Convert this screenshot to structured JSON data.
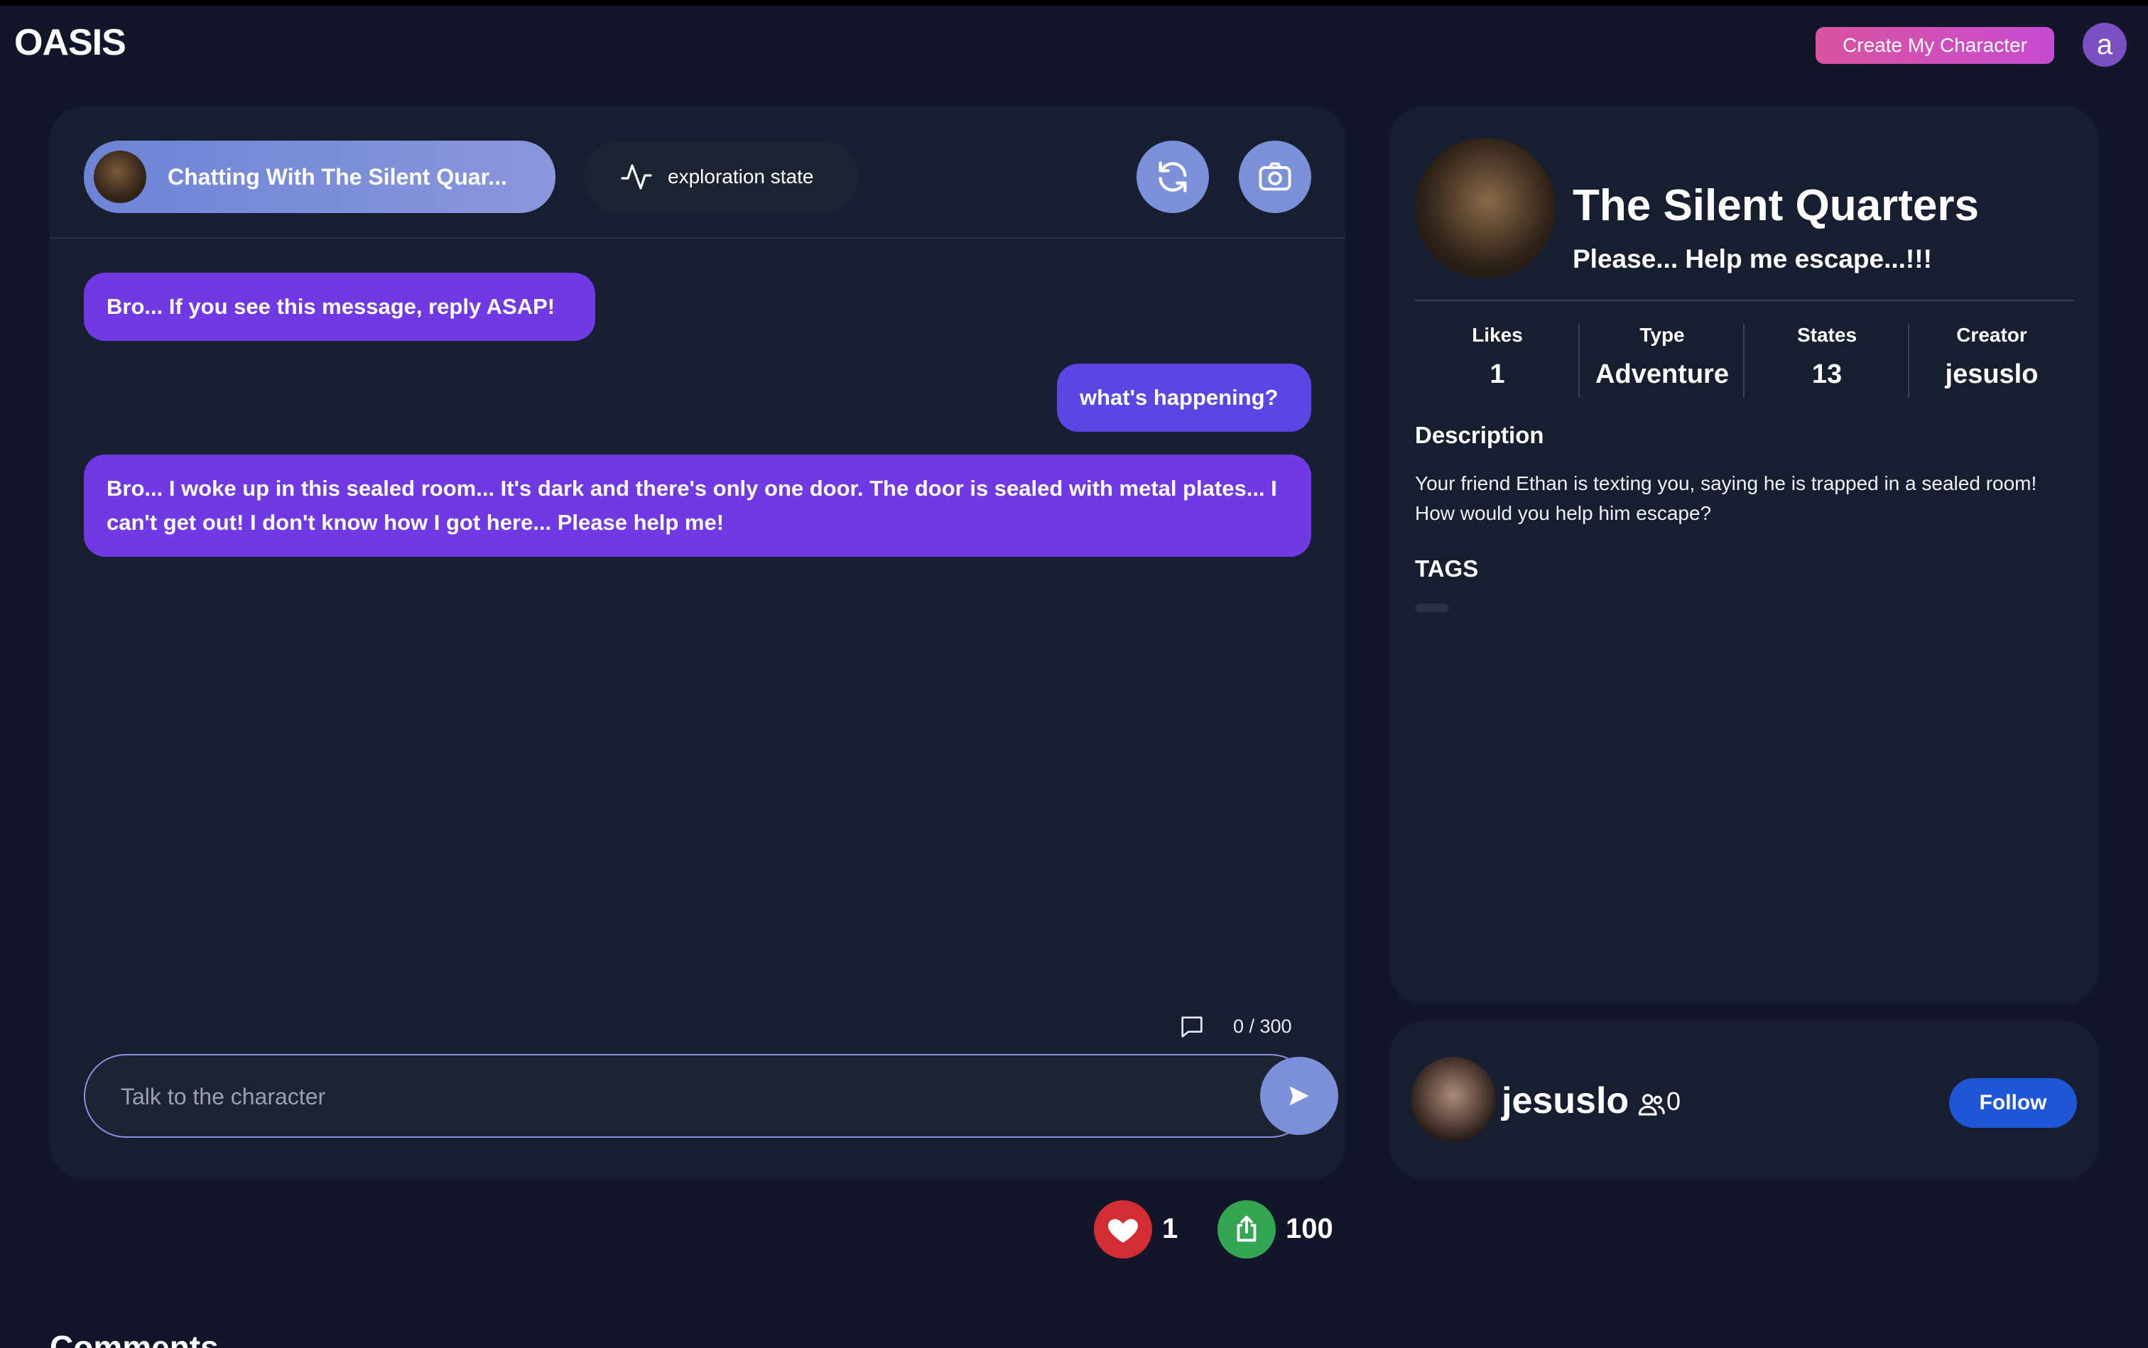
{
  "header": {
    "logo": "OASIS",
    "create_button": "Create My Character",
    "user_initial": "a"
  },
  "chat": {
    "chip_title": "Chatting With The Silent Quar...",
    "state_label": "exploration state",
    "refresh_icon": "refresh-icon",
    "camera_icon": "camera-icon",
    "messages": [
      {
        "role": "character",
        "text": "Bro... If you see this message, reply ASAP!"
      },
      {
        "role": "user",
        "text": "what's happening?"
      },
      {
        "role": "character",
        "text": "Bro... I woke up in this sealed room... It's dark and there's only one door. The door is sealed with metal plates... I can't get out! I don't know how I got here... Please help me!"
      }
    ],
    "counter": "0 / 300",
    "input_value": "",
    "input_placeholder": "Talk to the character"
  },
  "reactions": {
    "likes": "1",
    "shares": "100"
  },
  "comments_title": "Comments",
  "profile": {
    "name": "The Silent Quarters",
    "tagline": "Please... Help me escape...!!!",
    "stats": [
      {
        "label": "Likes",
        "value": "1"
      },
      {
        "label": "Type",
        "value": "Adventure"
      },
      {
        "label": "States",
        "value": "13"
      },
      {
        "label": "Creator",
        "value": "jesuslo"
      }
    ],
    "description_title": "Description",
    "description": "Your friend Ethan is texting you, saying he is trapped in a sealed room! How would you help him escape?",
    "tags_title": "TAGS"
  },
  "creator": {
    "name": "jesuslo",
    "followers": "0",
    "follow_button": "Follow"
  },
  "colors": {
    "background": "#111729",
    "panel": "#161e30",
    "bubble": "#7039e3",
    "accent_button": "#7c8fd9",
    "like": "#d12d33",
    "share": "#34a553",
    "follow": "#1f56d6"
  }
}
